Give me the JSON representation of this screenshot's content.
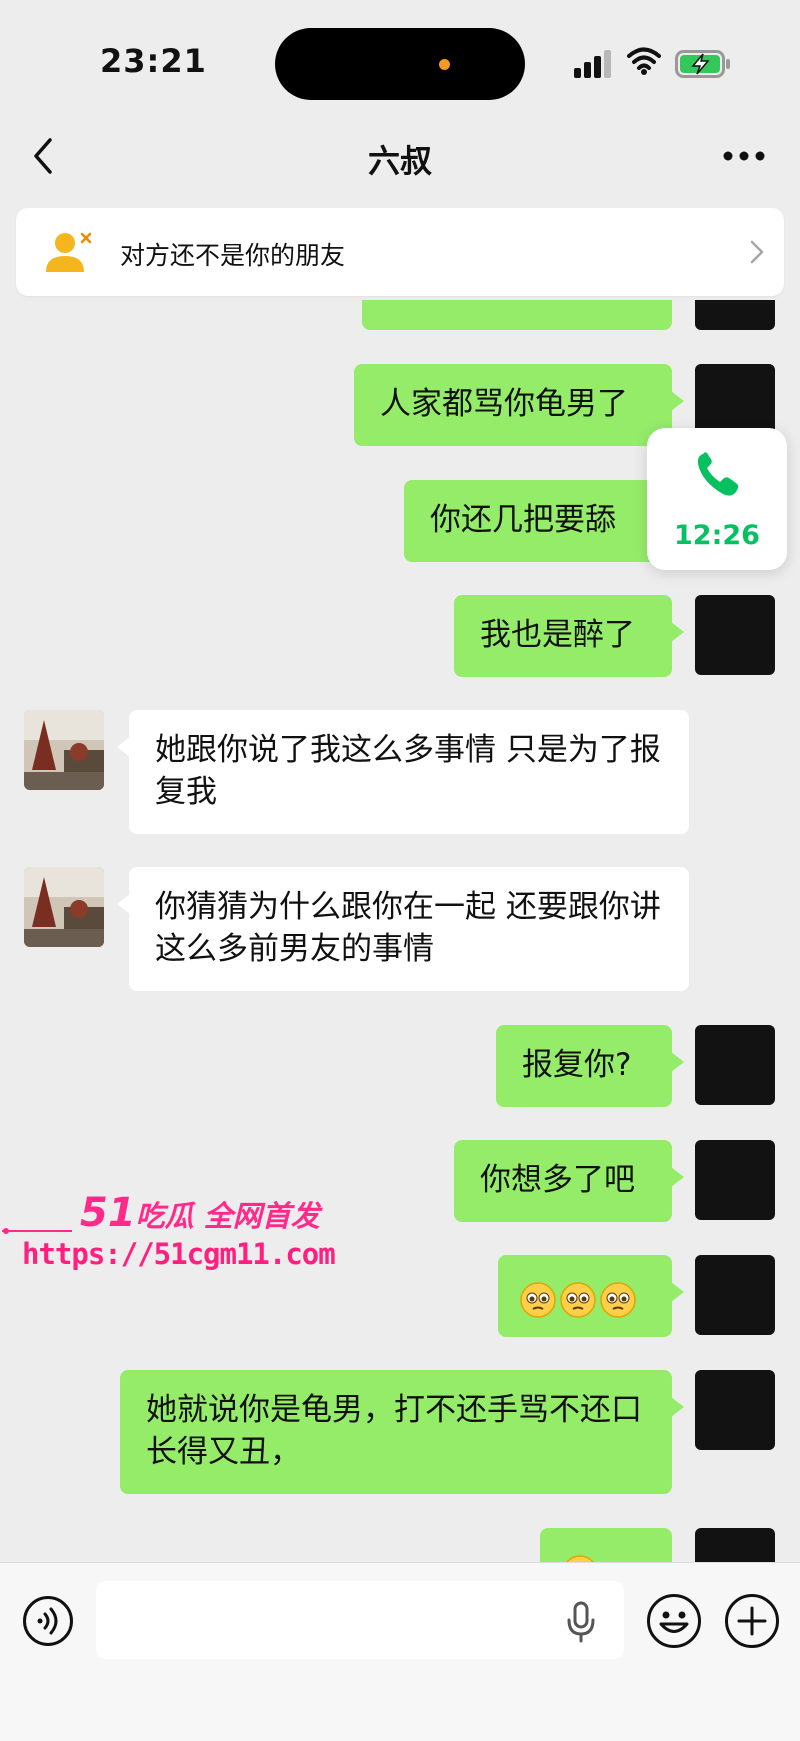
{
  "status_bar": {
    "time": "23:21"
  },
  "header": {
    "title": "六叔"
  },
  "friend_banner": {
    "text": "对方还不是你的朋友"
  },
  "call_float": {
    "duration": "12:26"
  },
  "messages": [
    {
      "from": "me",
      "text": ""
    },
    {
      "from": "me",
      "text": "人家都骂你龟男了"
    },
    {
      "from": "me",
      "text": "你还几把要舔"
    },
    {
      "from": "me",
      "text": "我也是醉了"
    },
    {
      "from": "peer",
      "text": "她跟你说了我这么多事情 只是为了报复我"
    },
    {
      "from": "peer",
      "text": "你猜猜为什么跟你在一起 还要跟你讲这么多前男友的事情"
    },
    {
      "from": "me",
      "text": "报复你?"
    },
    {
      "from": "me",
      "text": "你想多了吧"
    },
    {
      "from": "me",
      "emoji": [
        "pleading-face",
        "pleading-face",
        "pleading-face"
      ]
    },
    {
      "from": "me",
      "text": "她就说你是龟男，打不还手骂不还口长得又丑，"
    },
    {
      "from": "me",
      "emoji": [
        "pleading-face"
      ]
    }
  ],
  "watermark": {
    "brand_num": "51",
    "brand_text": "吃瓜 全网首发",
    "url": "https://51cgm11.com"
  },
  "input_bar": {
    "value": ""
  },
  "colors": {
    "me_bubble": "#95ec69",
    "peer_bubble": "#ffffff",
    "accent_green": "#07c160",
    "background": "#ededed"
  }
}
